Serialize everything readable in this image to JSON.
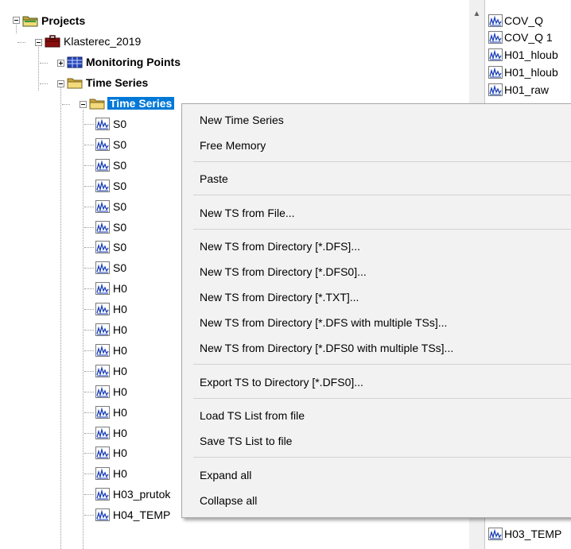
{
  "tree": {
    "root": "Projects",
    "project": "Klasterec_2019",
    "monitoring": "Monitoring Points",
    "timeseries_group": "Time Series",
    "timeseries_selected": "Time Series",
    "items": [
      "S0",
      "S0",
      "S0",
      "S0",
      "S0",
      "S0",
      "S0",
      "S0",
      "H0",
      "H0",
      "H0",
      "H0",
      "H0",
      "H0",
      "H0",
      "H0",
      "H0",
      "H0",
      "H03_prutok",
      "H04_TEMP"
    ]
  },
  "right_pane": {
    "items": [
      "COV_Q",
      "COV_Q 1",
      "H01_hloub",
      "H01_hloub",
      "H01_raw",
      "H03_TEMP"
    ]
  },
  "scrollbar": {
    "up_arrow": "▲"
  },
  "context_menu": {
    "new_time_series": "New Time Series",
    "free_memory": "Free Memory",
    "paste": "Paste",
    "new_ts_from_file": "New TS from File...",
    "dir_dfs": "New TS from Directory [*.DFS]...",
    "dir_dfs0": "New TS from Directory [*.DFS0]...",
    "dir_txt": "New TS from Directory [*.TXT]...",
    "dir_dfs_multi": "New TS from Directory [*.DFS with multiple TSs]...",
    "dir_dfs0_multi": "New TS from Directory [*.DFS0 with multiple TSs]...",
    "export_dfs0": "Export TS to Directory [*.DFS0]...",
    "load_list": "Load TS List from file",
    "save_list": "Save TS List to file",
    "expand_all": "Expand all",
    "collapse_all": "Collapse all"
  },
  "colors": {
    "selection": "#0078d7",
    "folder": "#e8c65a",
    "menu_bg": "#f2f2f2"
  }
}
